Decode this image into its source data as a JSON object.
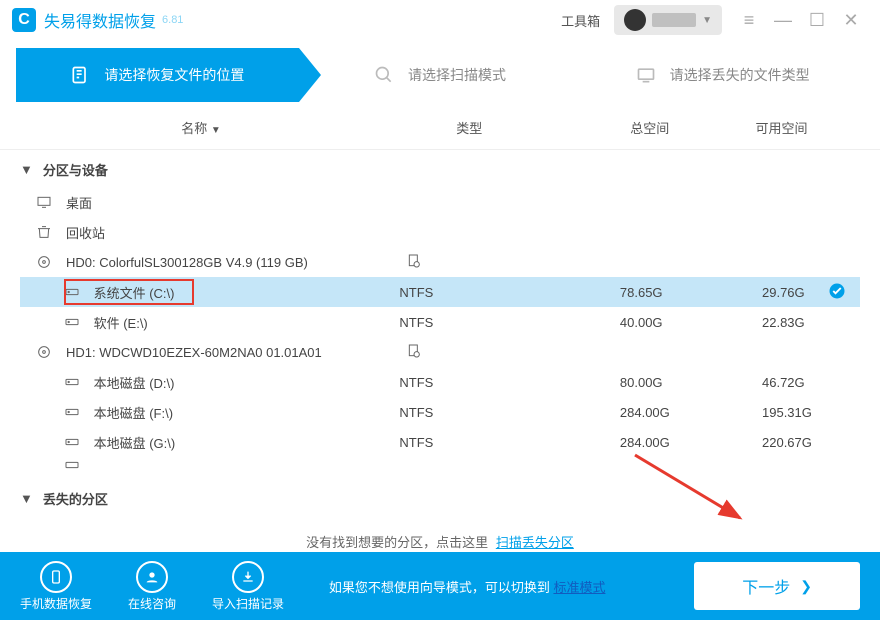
{
  "app": {
    "title": "失易得数据恢复",
    "version": "6.81",
    "toolbox": "工具箱"
  },
  "steps": {
    "s1": "请选择恢复文件的位置",
    "s2": "请选择扫描模式",
    "s3": "请选择丢失的文件类型"
  },
  "cols": {
    "name": "名称",
    "type": "类型",
    "total": "总空间",
    "avail": "可用空间"
  },
  "group1": "分区与设备",
  "rows": {
    "desktop": "桌面",
    "recycle": "回收站",
    "hd0": "HD0:  ColorfulSL300128GB V4.9 (119 GB)",
    "c": {
      "label": "系统文件 (C:\\)",
      "type": "NTFS",
      "total": "78.65G",
      "avail": "29.76G"
    },
    "e": {
      "label": "软件 (E:\\)",
      "type": "NTFS",
      "total": "40.00G",
      "avail": "22.83G"
    },
    "hd1": "HD1:  WDCWD10EZEX-60M2NA0 01.01A01",
    "d": {
      "label": "本地磁盘 (D:\\)",
      "type": "NTFS",
      "total": "80.00G",
      "avail": "46.72G"
    },
    "f": {
      "label": "本地磁盘 (F:\\)",
      "type": "NTFS",
      "total": "284.00G",
      "avail": "195.31G"
    },
    "g": {
      "label": "本地磁盘 (G:\\)",
      "type": "NTFS",
      "total": "284.00G",
      "avail": "220.67G"
    }
  },
  "group2": "丢失的分区",
  "lost": {
    "msg": "没有找到想要的分区，点击这里",
    "link": "扫描丢失分区"
  },
  "bottom": {
    "b1": "手机数据恢复",
    "b2": "在线咨询",
    "b3": "导入扫描记录",
    "msg": "如果您不想使用向导模式，可以切换到",
    "link": "标准模式",
    "next": "下一步"
  }
}
